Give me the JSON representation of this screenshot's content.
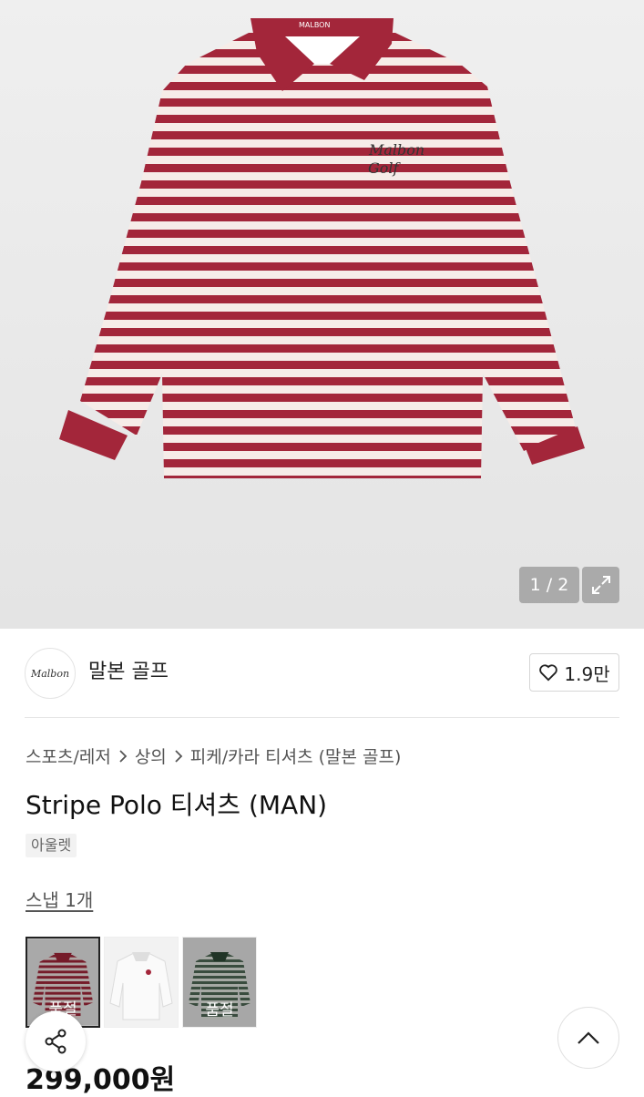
{
  "hero": {
    "image_icon": "striped-polo-shirt",
    "shirt_color": "#a3263a",
    "counter": "1 / 2"
  },
  "brand": {
    "logo_text": "Malbon",
    "name": "말본 골프",
    "likes": "1.9만"
  },
  "breadcrumb": [
    "스포츠/레저",
    "상의",
    "피케/카라 티셔츠 (말본 골프)"
  ],
  "product": {
    "title": "Stripe Polo 티셔츠 (MAN)",
    "tag": "아울렛",
    "snap": "스냅 1개",
    "price": "299,000원"
  },
  "variants": [
    {
      "color": "#a3263a",
      "soldout": "품절"
    },
    {
      "color": "#f4f4f4",
      "soldout": ""
    },
    {
      "color": "#6f8272",
      "soldout": "품절"
    }
  ]
}
